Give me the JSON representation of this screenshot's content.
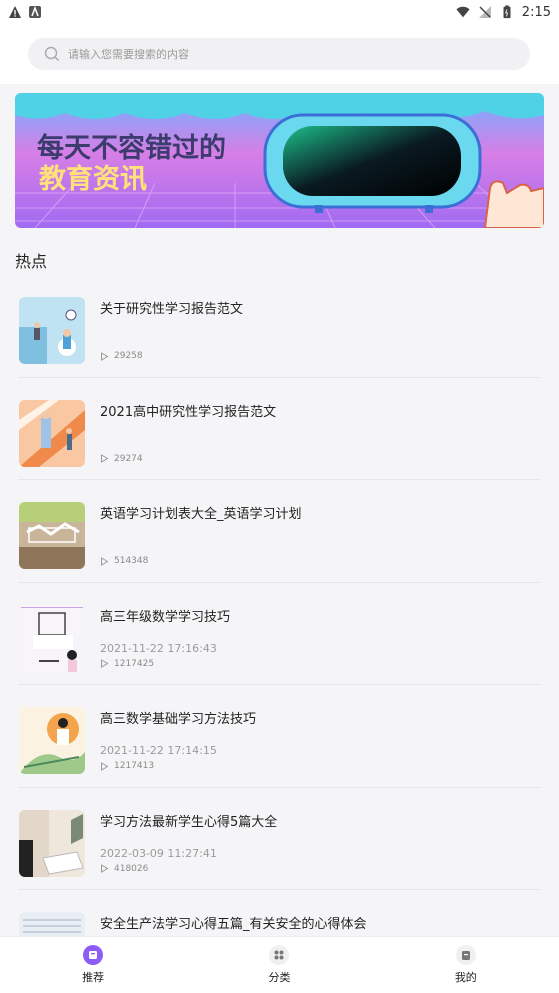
{
  "status_bar": {
    "time": "2:15"
  },
  "search": {
    "placeholder": "请输入您需要搜索的内容"
  },
  "banner": {
    "line1": "每天不容错过的",
    "line2": "教育资讯"
  },
  "section": {
    "title": "热点"
  },
  "articles": [
    {
      "title": "关于研究性学习报告范文",
      "date": "",
      "views": "29258",
      "thumb": "thumb-study-people"
    },
    {
      "title": "2021高中研究性学习报告范文",
      "date": "",
      "views": "29274",
      "thumb": "thumb-study-orange"
    },
    {
      "title": "英语学习计划表大全_英语学习计划",
      "date": "",
      "views": "514348",
      "thumb": "thumb-plan"
    },
    {
      "title": "高三年级数学学习技巧",
      "date": "2021-11-22 17:16:43",
      "views": "1217425",
      "thumb": "thumb-knowledge"
    },
    {
      "title": "高三数学基础学习方法技巧",
      "date": "2021-11-22 17:14:15",
      "views": "1217413",
      "thumb": "thumb-knowledge-orange"
    },
    {
      "title": "学习方法最新学生心得5篇大全",
      "date": "2022-03-09 11:27:41",
      "views": "418026",
      "thumb": "thumb-desk"
    },
    {
      "title": "安全生产法学习心得五篇_有关安全的心得体会",
      "date": "",
      "views": "",
      "thumb": "thumb-doc"
    }
  ],
  "bottom_nav": {
    "items": [
      {
        "label": "推荐",
        "icon": "recommend-icon",
        "active": true
      },
      {
        "label": "分类",
        "icon": "category-icon",
        "active": false
      },
      {
        "label": "我的",
        "icon": "profile-icon",
        "active": false
      }
    ]
  },
  "colors": {
    "accent": "#8b5cf6",
    "banner_pink": "#e679d6",
    "banner_cyan": "#4fd2e6"
  }
}
